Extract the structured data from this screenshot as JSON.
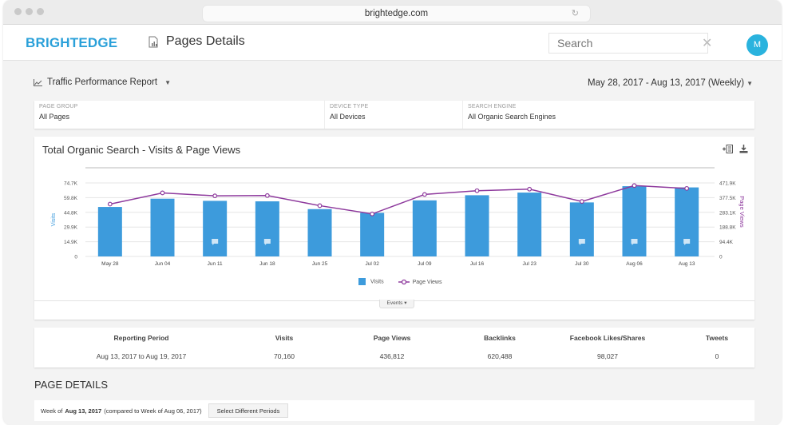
{
  "browser": {
    "url": "brightedge.com"
  },
  "header": {
    "logo": "BRIGHTEDGE",
    "page_title": "Pages Details",
    "search_placeholder": "Search",
    "avatar_initial": "M"
  },
  "report": {
    "name": "Traffic Performance Report",
    "date_range": "May 28, 2017 - Aug 13, 2017 (Weekly)"
  },
  "filters": [
    {
      "label": "PAGE GROUP",
      "value": "All Pages"
    },
    {
      "label": "DEVICE TYPE",
      "value": "All Devices"
    },
    {
      "label": "SEARCH ENGINE",
      "value": "All Organic Search Engines"
    }
  ],
  "chart_card": {
    "events_label": "Events"
  },
  "colors": {
    "brand": "#2aa0d9",
    "bar": "#3d9bdc",
    "line": "#8e3a9d"
  },
  "chart_data": {
    "type": "bar",
    "title": "Total Organic Search - Visits & Page Views",
    "categories": [
      "May 28",
      "Jun 04",
      "Jun 11",
      "Jun 18",
      "Jun 25",
      "Jul 02",
      "Jul 09",
      "Jul 16",
      "Jul 23",
      "Jul 30",
      "Aug 06",
      "Aug 13"
    ],
    "series": [
      {
        "name": "Visits",
        "type": "bar",
        "axis": "left",
        "values": [
          50300,
          58700,
          56500,
          56000,
          48100,
          44300,
          57000,
          62200,
          64900,
          54900,
          71400,
          70160
        ]
      },
      {
        "name": "Page Views",
        "type": "line",
        "axis": "right",
        "values": [
          336000,
          408000,
          389000,
          391000,
          326000,
          273000,
          398000,
          422000,
          432000,
          353000,
          455000,
          436812
        ]
      }
    ],
    "events": [
      false,
      false,
      true,
      true,
      false,
      false,
      false,
      false,
      false,
      true,
      true,
      true
    ],
    "ylabel": "Visits",
    "y2label": "Page Views",
    "yticks": [
      "0",
      "14.9K",
      "29.9K",
      "44.8K",
      "59.8K",
      "74.7K"
    ],
    "y2ticks": [
      "0",
      "94.4K",
      "188.8K",
      "283.1K",
      "377.5K",
      "471.9K"
    ],
    "ylim": [
      0,
      74700
    ],
    "y2lim": [
      0,
      471900
    ],
    "grid": true,
    "legend": "bottom-center"
  },
  "summary": {
    "headers": [
      "Reporting Period",
      "Visits",
      "Page Views",
      "Backlinks",
      "Facebook Likes/Shares",
      "Tweets"
    ],
    "values": [
      "Aug 13, 2017 to Aug 19, 2017",
      "70,160",
      "436,812",
      "620,488",
      "98,027",
      "0"
    ]
  },
  "page_details": {
    "title": "PAGE DETAILS",
    "week_prefix": "Week of",
    "week_bold": "Aug 13, 2017",
    "week_suffix": "(compared to Week of Aug 06, 2017)",
    "select_button": "Select Different Periods"
  }
}
